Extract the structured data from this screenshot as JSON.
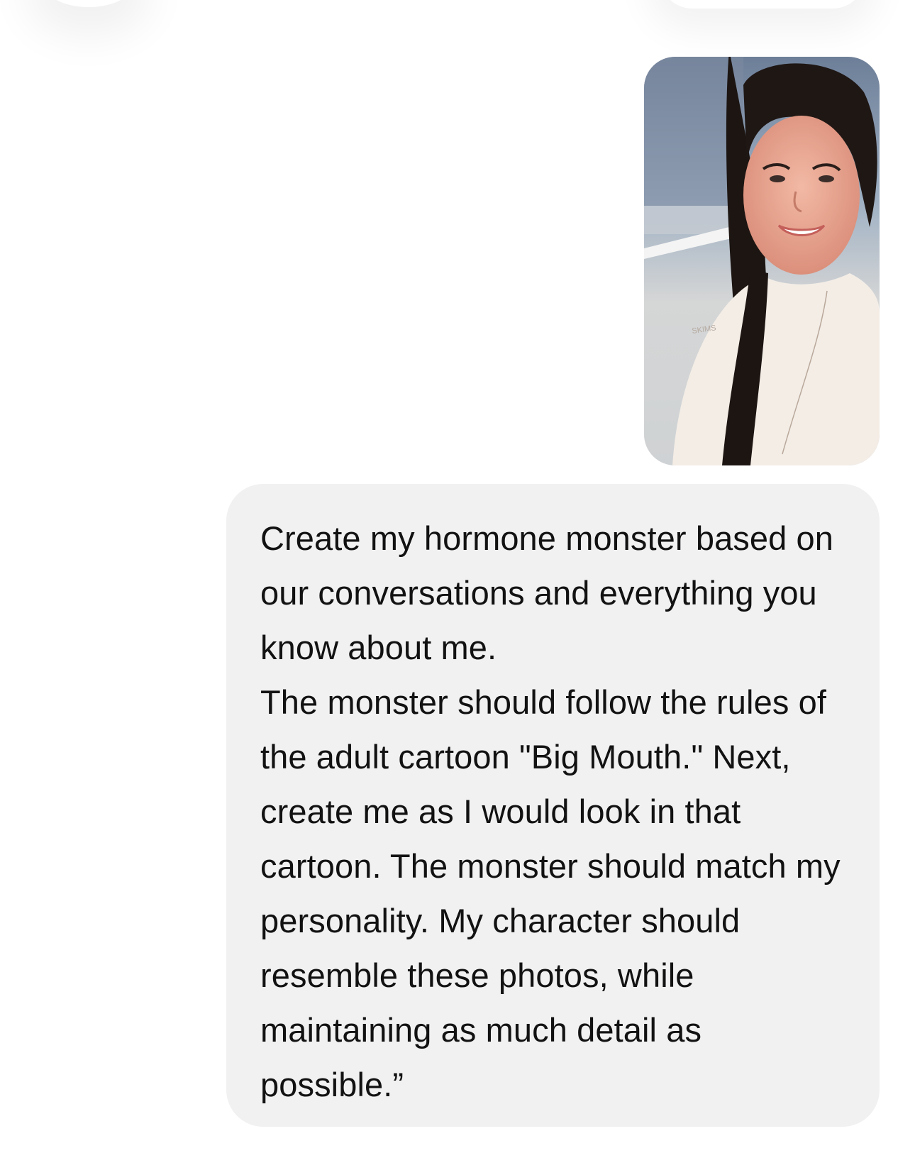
{
  "chat": {
    "attachment": {
      "type": "photo",
      "alt": "selfie photo attachment"
    },
    "message": {
      "text": "Create my hormone monster based on our conversations and everything you know about me.\nThe monster should follow the rules of the adult cartoon \"Big Mouth.\" Next, create me as I would look in that cartoon. The monster should match my personality. My character should resemble these photos, while maintaining as much detail as possible.”"
    }
  },
  "colors": {
    "background": "#ffffff",
    "bubble": "#f1f1f2",
    "text": "#121212"
  }
}
